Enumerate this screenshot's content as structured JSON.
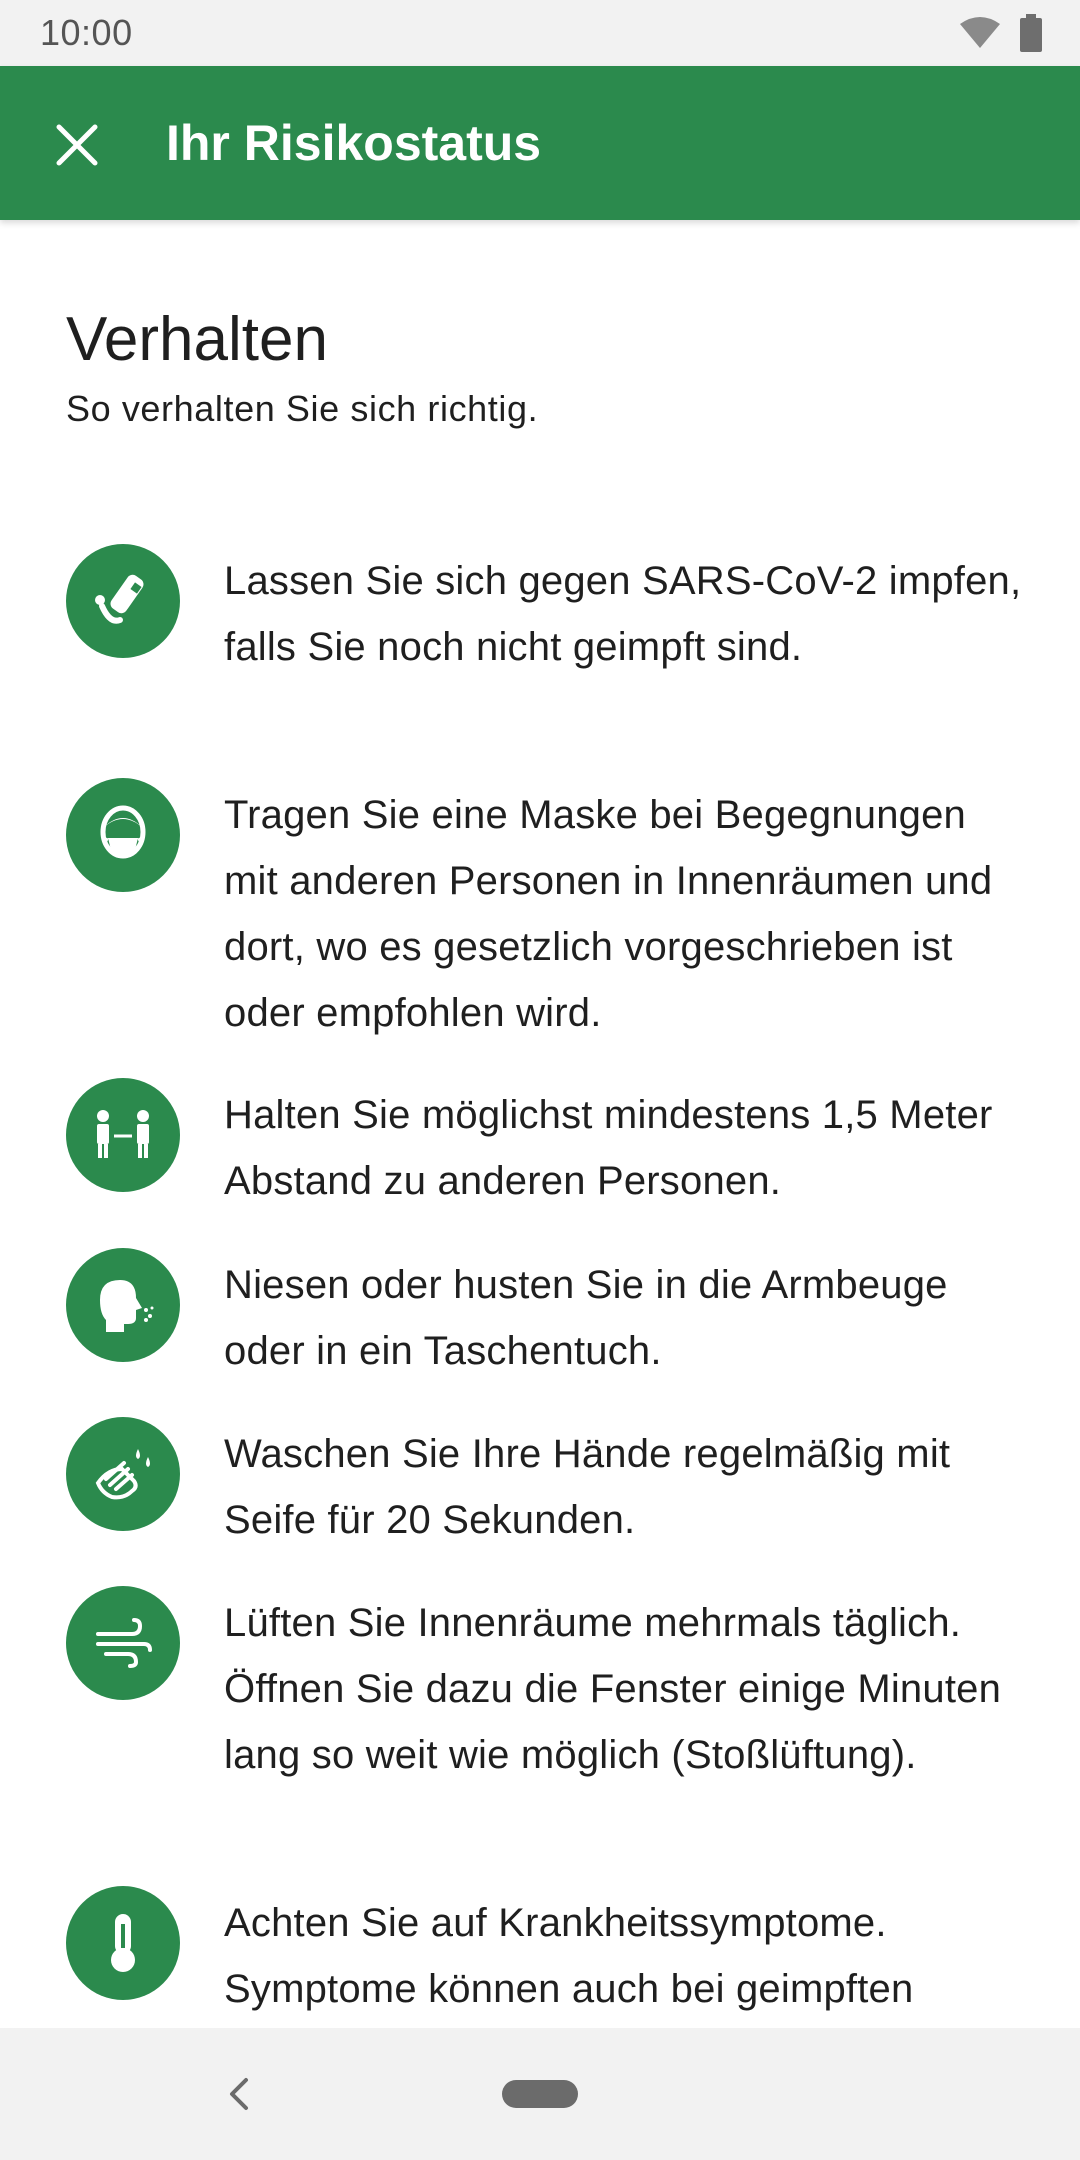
{
  "status_bar": {
    "time": "10:00",
    "icons": [
      "wifi-icon",
      "battery-icon"
    ]
  },
  "app_bar": {
    "close_icon": "close-icon",
    "title": "Ihr Risikostatus",
    "background": "#2b8a4d"
  },
  "main": {
    "title": "Verhalten",
    "subtitle": "So verhalten Sie sich richtig.",
    "tips": [
      {
        "icon": "vaccine-icon",
        "text": "Lassen Sie sich gegen SARS-CoV-2 impfen, falls Sie noch nicht geimpft sind."
      },
      {
        "icon": "mask-icon",
        "text": "Tragen Sie eine Maske bei Begegnungen mit anderen Personen in Innenräumen und dort, wo es gesetzlich vorgeschrieben ist oder empfohlen wird."
      },
      {
        "icon": "distance-icon",
        "text": "Halten Sie möglichst mindestens 1,5 Meter Abstand zu anderen Personen."
      },
      {
        "icon": "sneeze-icon",
        "text": "Niesen oder husten Sie in die Armbeuge oder in ein Taschentuch."
      },
      {
        "icon": "handwash-icon",
        "text": "Waschen Sie Ihre Hände regelmäßig mit Seife für 20 Sekunden."
      },
      {
        "icon": "ventilation-icon",
        "text": "Lüften Sie Innenräume mehrmals täglich. Öffnen Sie dazu die Fenster einige Minuten lang so weit wie möglich (Stoßlüftung)."
      },
      {
        "icon": "thermometer-icon",
        "text": "Achten Sie auf Krankheitssymptome. Symptome können auch bei geimpften"
      }
    ]
  },
  "nav_bar": {
    "back_icon": "back-icon",
    "home_icon": "home-pill-icon"
  }
}
